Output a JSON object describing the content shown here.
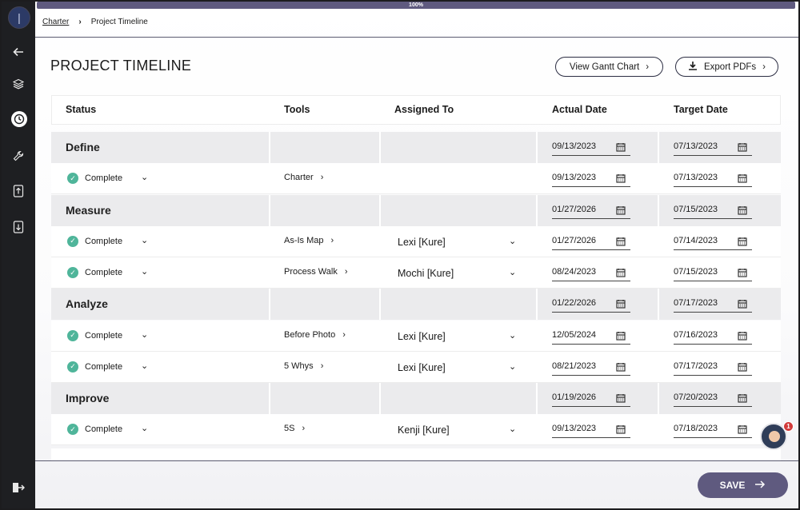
{
  "progress": {
    "label": "100%",
    "value": 100
  },
  "breadcrumb": {
    "parent": "Charter",
    "current": "Project Timeline"
  },
  "page": {
    "title": "PROJECT TIMELINE"
  },
  "actions": {
    "gantt_label": "View Gantt Chart",
    "export_label": "Export PDFs",
    "save_label": "SAVE"
  },
  "columns": [
    "Status",
    "Tools",
    "Assigned To",
    "Actual Date",
    "Target Date"
  ],
  "phases": [
    {
      "name": "Define",
      "actual": "09/13/2023",
      "target": "07/13/2023",
      "items": [
        {
          "status": "Complete",
          "tool": "Charter",
          "assignee": "",
          "actual": "09/13/2023",
          "target": "07/13/2023"
        }
      ]
    },
    {
      "name": "Measure",
      "actual": "01/27/2026",
      "target": "07/15/2023",
      "items": [
        {
          "status": "Complete",
          "tool": "As-Is Map",
          "assignee": "Lexi [Kure]",
          "actual": "01/27/2026",
          "target": "07/14/2023"
        },
        {
          "status": "Complete",
          "tool": "Process Walk",
          "assignee": "Mochi [Kure]",
          "actual": "08/24/2023",
          "target": "07/15/2023"
        }
      ]
    },
    {
      "name": "Analyze",
      "actual": "01/22/2026",
      "target": "07/17/2023",
      "items": [
        {
          "status": "Complete",
          "tool": "Before Photo",
          "assignee": "Lexi [Kure]",
          "actual": "12/05/2024",
          "target": "07/16/2023"
        },
        {
          "status": "Complete",
          "tool": "5 Whys",
          "assignee": "Lexi [Kure]",
          "actual": "08/21/2023",
          "target": "07/17/2023"
        }
      ]
    },
    {
      "name": "Improve",
      "actual": "01/19/2026",
      "target": "07/20/2023",
      "items": [
        {
          "status": "Complete",
          "tool": "5S",
          "assignee": "Kenji [Kure]",
          "actual": "09/13/2023",
          "target": "07/18/2023"
        }
      ]
    }
  ],
  "notifications": {
    "count": "1"
  },
  "icons": {
    "sidebar": [
      "back-arrow-icon",
      "layers-icon",
      "clock-icon",
      "wrench-icon",
      "upload-icon",
      "download-icon",
      "logout-icon"
    ],
    "calendar": "calendar-icon",
    "check": "check-circle-icon"
  },
  "colors": {
    "accent": "#5f5a7f",
    "complete": "#4fb59a",
    "sidebar": "#1e1f22",
    "badge": "#d23a3a"
  }
}
